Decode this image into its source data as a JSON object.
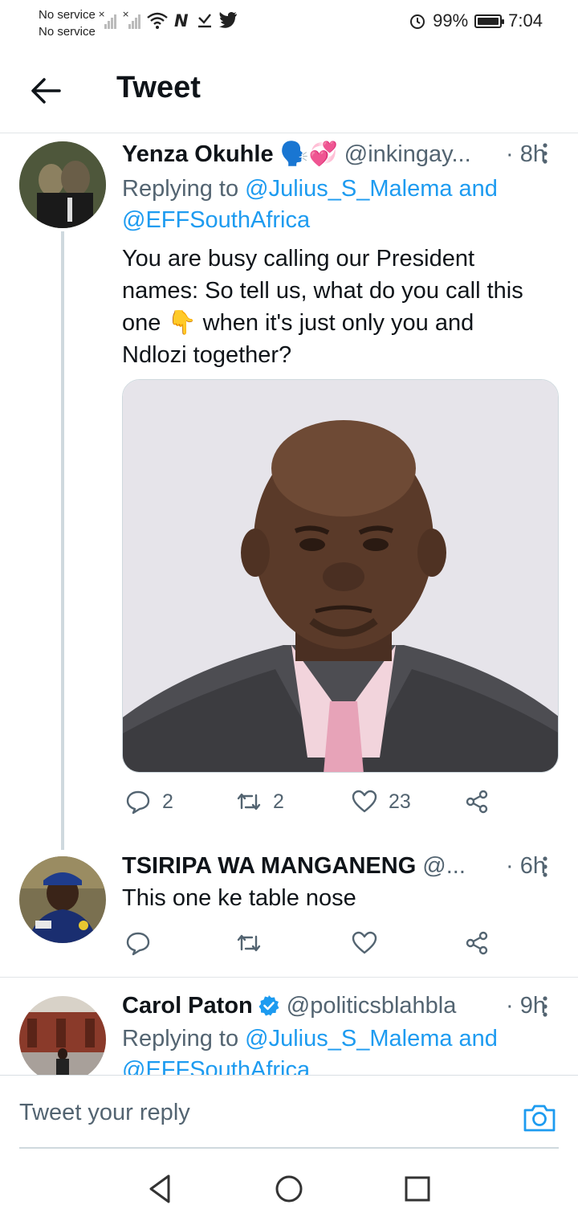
{
  "status_bar": {
    "carrier_1": "No service",
    "carrier_2": "No service",
    "battery": "99%",
    "battery_level": 0.99,
    "time": "7:04",
    "icons": [
      "signal-x-icon",
      "signal-x-icon",
      "wifi-icon",
      "n-app-icon",
      "download-check-icon",
      "twitter-bird-icon",
      "alarm-icon",
      "battery-icon"
    ]
  },
  "header": {
    "back_icon": "arrow-left-icon",
    "title": "Tweet"
  },
  "tweets": [
    {
      "name": "Yenza Okuhle",
      "emojis": "🗣️💞",
      "handle": "@inkingay...",
      "time": "· 8h",
      "replying_prefix": "Replying to ",
      "replying_link_1": "@Julius_S_Malema and",
      "replying_link_2": "@EFFSouthAfrica",
      "text_line_1": "You are busy calling our President",
      "text_line_2": "names: So tell us, what do you call this",
      "text_line_3a": "one ",
      "text_emoji": "👇",
      "text_line_3b": " when it's just only you and",
      "text_line_4": "Ndlozi together?",
      "media": "photo of a bald man in a grey suit and pink tie, frowning",
      "reply_count": "2",
      "retweet_count": "2",
      "like_count": "23"
    },
    {
      "name": "TSIRIPA WA MANGANENG",
      "handle": "@...",
      "time": "· 6h",
      "text": "This one ke table nose",
      "reply_count": "",
      "retweet_count": "",
      "like_count": ""
    },
    {
      "name": "Carol Paton",
      "verified": true,
      "handle": "@politicsblahbla",
      "time": "· 9h",
      "replying_prefix": "Replying to ",
      "replying_link_1": "@Julius_S_Malema and",
      "replying_link_2": "@EFFSouthAfrica"
    }
  ],
  "reply_bar": {
    "placeholder": "Tweet your reply",
    "camera_icon": "camera-icon"
  },
  "nav_bar": {
    "buttons": [
      "nav-back-icon",
      "nav-home-icon",
      "nav-recents-icon"
    ]
  },
  "colors": {
    "link": "#1d9bf0",
    "secondary_text": "#536471",
    "primary_text": "#0f1419",
    "divider": "#e1e5e8",
    "verified": "#1d9bf0"
  }
}
